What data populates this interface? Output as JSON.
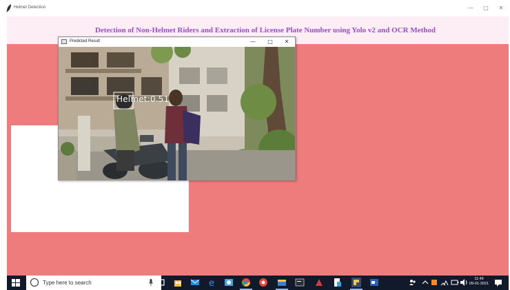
{
  "app": {
    "title": "Helmet Detection",
    "header_title": "Detection of Non-Helmet Riders and Extraction of License Plate Number using Yolo v2 and OCR Method"
  },
  "window_controls": {
    "minimize": "—",
    "maximize": "□",
    "close": "✕"
  },
  "popup": {
    "title": "Predicted Result",
    "minimize": "—",
    "maximize": "□",
    "close": "✕",
    "detection_label": "Helmet:0.51"
  },
  "taskbar": {
    "search_placeholder": "Type here to search",
    "clock_time": "11:49",
    "clock_date": "09-01-2021",
    "icons": [
      "task-view-icon",
      "store-icon",
      "mail-icon",
      "edge-icon",
      "photos-icon",
      "chrome-icon",
      "media-icon",
      "files-icon",
      "terminal-icon",
      "app-icon",
      "docs-icon",
      "python-icon",
      "word-icon"
    ]
  },
  "colors": {
    "canvas": "#ee7c7c",
    "header_band": "#fdeef6",
    "header_text": "#9a4dcf",
    "taskbar": "#101a2b"
  }
}
